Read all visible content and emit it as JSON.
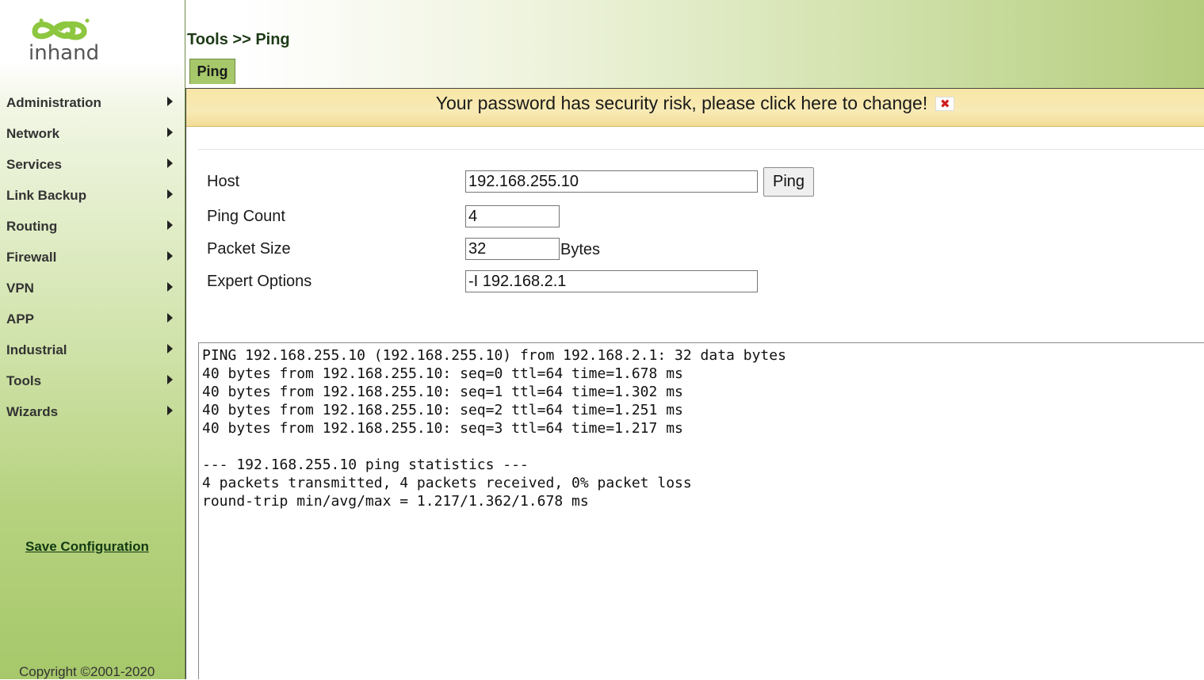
{
  "branding": {
    "logo_text": "inhand",
    "logo_color": "#8dc63f"
  },
  "sidebar": {
    "items": [
      {
        "label": "Administration"
      },
      {
        "label": "Network"
      },
      {
        "label": "Services"
      },
      {
        "label": "Link Backup"
      },
      {
        "label": "Routing"
      },
      {
        "label": "Firewall"
      },
      {
        "label": "VPN"
      },
      {
        "label": "APP"
      },
      {
        "label": "Industrial"
      },
      {
        "label": "Tools"
      },
      {
        "label": "Wizards"
      }
    ],
    "save_config_label": "Save Configuration",
    "copyright": "Copyright ©2001-2020"
  },
  "header": {
    "breadcrumb": "Tools >> Ping",
    "tab_label": "Ping"
  },
  "warning": {
    "text": "Your password has security risk, please click here to change!",
    "close_glyph": "✖"
  },
  "form": {
    "host": {
      "label": "Host",
      "value": "192.168.255.10"
    },
    "ping_button": "Ping",
    "ping_count": {
      "label": "Ping Count",
      "value": "4"
    },
    "packet_size": {
      "label": "Packet Size",
      "value": "32",
      "unit": "Bytes"
    },
    "expert_options": {
      "label": "Expert Options",
      "value": "-I 192.168.2.1"
    }
  },
  "output": {
    "text": "PING 192.168.255.10 (192.168.255.10) from 192.168.2.1: 32 data bytes\n40 bytes from 192.168.255.10: seq=0 ttl=64 time=1.678 ms\n40 bytes from 192.168.255.10: seq=1 ttl=64 time=1.302 ms\n40 bytes from 192.168.255.10: seq=2 ttl=64 time=1.251 ms\n40 bytes from 192.168.255.10: seq=3 ttl=64 time=1.217 ms\n\n--- 192.168.255.10 ping statistics ---\n4 packets transmitted, 4 packets received, 0% packet loss\nround-trip min/avg/max = 1.217/1.362/1.678 ms"
  }
}
